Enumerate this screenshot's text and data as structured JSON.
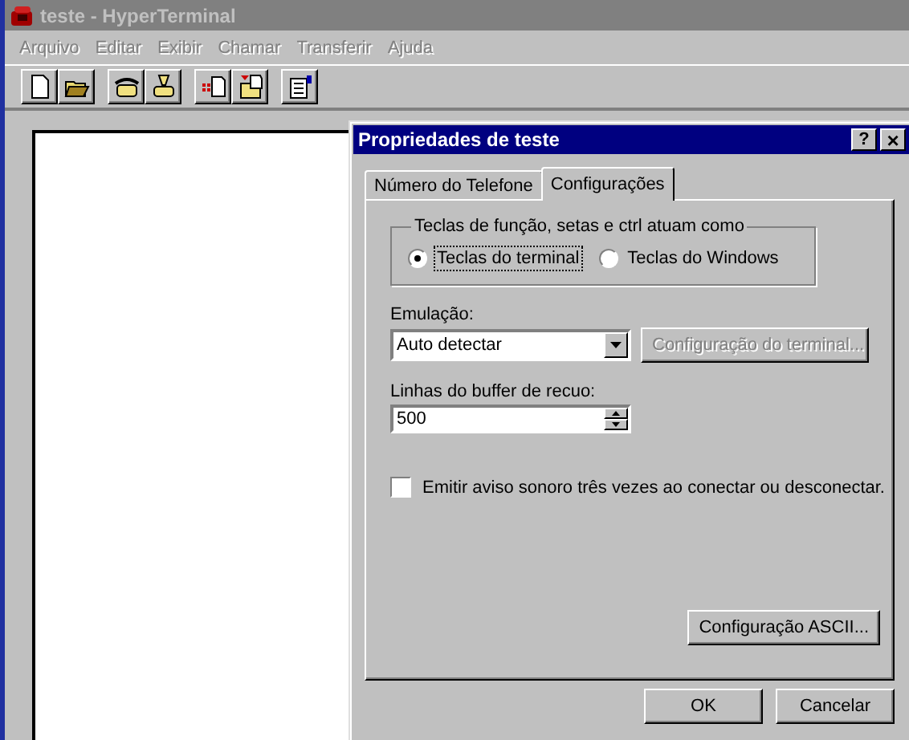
{
  "window": {
    "title": "teste - HyperTerminal",
    "active": false
  },
  "menu": [
    {
      "label": "Arquivo"
    },
    {
      "label": "Editar"
    },
    {
      "label": "Exibir"
    },
    {
      "label": "Chamar"
    },
    {
      "label": "Transferir"
    },
    {
      "label": "Ajuda"
    }
  ],
  "toolbar": [
    {
      "kind": "new"
    },
    {
      "kind": "open"
    },
    {
      "kind": "phone"
    },
    {
      "kind": "hangup"
    },
    {
      "kind": "send"
    },
    {
      "kind": "receive"
    },
    {
      "kind": "properties"
    }
  ],
  "dialog": {
    "title": "Propriedades de teste",
    "help": "?",
    "close": "×",
    "tabs": [
      {
        "label": "Número do Telefone",
        "selected": false
      },
      {
        "label": "Configurações",
        "selected": true
      }
    ],
    "keys_group": {
      "title": "Teclas de função, setas e ctrl atuam como",
      "options": [
        {
          "label": "Teclas do terminal",
          "selected": true
        },
        {
          "label": "Teclas do Windows",
          "selected": false
        }
      ]
    },
    "emulation": {
      "label": "Emulação:",
      "value": "Auto detectar",
      "button": "Configuração do terminal...",
      "button_disabled": true
    },
    "buffer": {
      "label": "Linhas do buffer de recuo:",
      "value": "500"
    },
    "beep": {
      "label": "Emitir aviso sonoro três vezes ao conectar ou desconectar.",
      "checked": false
    },
    "ascii_button": "Configuração ASCII...",
    "buttons": [
      "OK",
      "Cancelar"
    ]
  }
}
